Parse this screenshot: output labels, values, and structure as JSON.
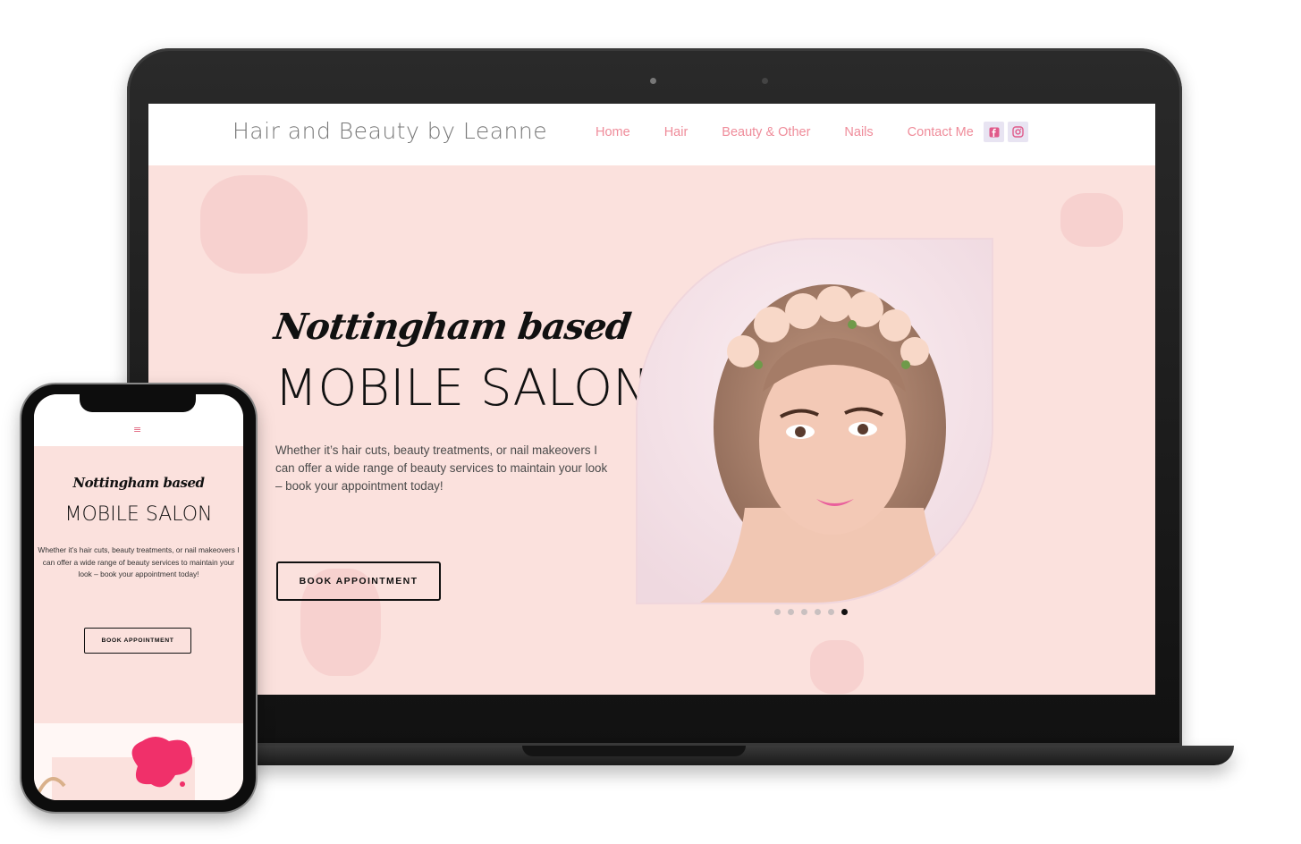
{
  "site": {
    "title": "Hair and Beauty by Leanne",
    "nav": [
      "Home",
      "Hair",
      "Beauty & Other",
      "Nails",
      "Contact Me"
    ],
    "social": [
      "facebook-icon",
      "instagram-icon"
    ],
    "brand_color": "#ef8c9a",
    "hero_bg": "#fbe1dd"
  },
  "hero": {
    "script_title": "Nottingham based",
    "title": "MOBILE SALON",
    "paragraph": "Whether it’s hair cuts, beauty treatments, or nail makeovers I can offer a wide range of beauty services to maintain your look – book your appointment today!",
    "button": "BOOK APPOINTMENT",
    "slides_total": 6,
    "slide_active": 6
  },
  "mobile": {
    "menu_icon": "≡",
    "script_title": "Nottingham based",
    "title": "MOBILE SALON",
    "paragraph": "Whether it’s hair cuts, beauty treatments, or nail makeovers I can offer a wide range of beauty services to maintain your look – book your appointment today!",
    "button": "BOOK APPOINTMENT"
  }
}
